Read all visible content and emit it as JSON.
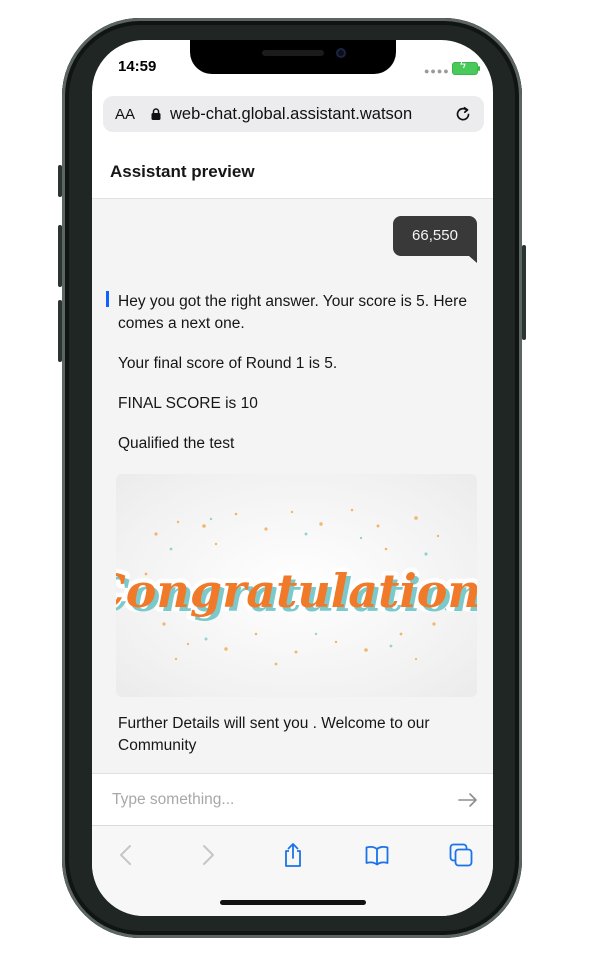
{
  "status_bar": {
    "time": "14:59"
  },
  "browser": {
    "aa_label": "AA",
    "url": "web-chat.global.assistant.watson"
  },
  "header": {
    "title": "Assistant preview"
  },
  "chat": {
    "user_message": "66,550",
    "bot_messages": [
      "Hey you got the right answer. Your score is 5. Here comes a next one.",
      "Your final score of Round 1 is 5.",
      "FINAL SCORE is 10",
      "Qualified the test"
    ],
    "image_text": "Congratulations",
    "closing_message": "Further Details will sent you . Welcome to our Community"
  },
  "input": {
    "placeholder": "Type something..."
  },
  "colors": {
    "accent": "#0f62fe",
    "user_bubble": "#393939",
    "safari_blue": "#1a73e8"
  },
  "icons": [
    "lock-icon",
    "reload-icon",
    "send-icon",
    "back-icon",
    "forward-icon",
    "share-icon",
    "bookmarks-icon",
    "tabs-icon"
  ]
}
